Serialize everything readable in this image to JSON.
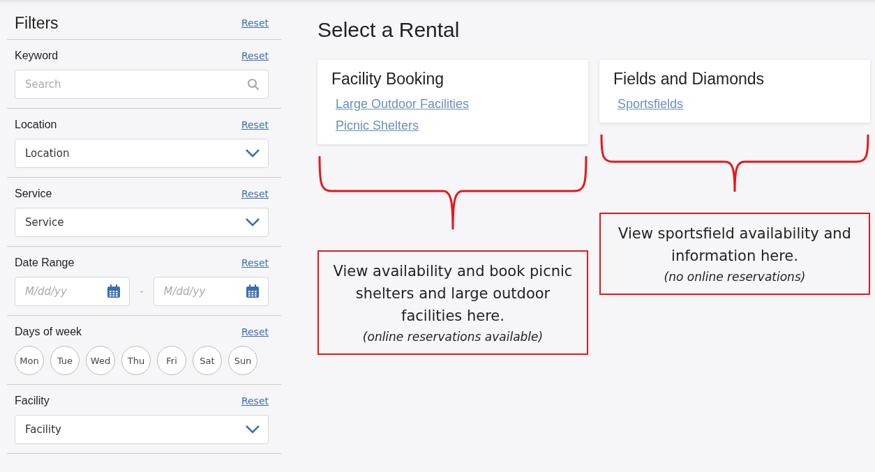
{
  "sidebar": {
    "title": "Filters",
    "reset": "Reset",
    "sections": [
      {
        "kind": "search",
        "label": "Keyword",
        "reset": "Reset",
        "placeholder": "Search"
      },
      {
        "kind": "select",
        "label": "Location",
        "reset": "Reset",
        "value": "Location"
      },
      {
        "kind": "select",
        "label": "Service",
        "reset": "Reset",
        "value": "Service"
      },
      {
        "kind": "dates",
        "label": "Date Range",
        "reset": "Reset",
        "from_placeholder": "M/dd/yy",
        "separator": "-",
        "to_placeholder": "M/dd/yy"
      },
      {
        "kind": "days",
        "label": "Days of week",
        "reset": "Reset",
        "days": [
          {
            "label": "Mon",
            "selected": false
          },
          {
            "label": "Tue",
            "selected": false
          },
          {
            "label": "Wed",
            "selected": false
          },
          {
            "label": "Thu",
            "selected": false
          },
          {
            "label": "Fri",
            "selected": false
          },
          {
            "label": "Sat",
            "selected": false
          },
          {
            "label": "Sun",
            "selected": false
          }
        ]
      },
      {
        "kind": "select",
        "label": "Facility",
        "reset": "Reset",
        "value": "Facility"
      }
    ]
  },
  "main": {
    "title": "Select a Rental",
    "categories": [
      {
        "title": "Facility Booking",
        "links": [
          "Large Outdoor Facilities",
          "Picnic Shelters"
        ],
        "callout": {
          "text": "View availability and book picnic shelters and large outdoor facilities here.",
          "note": "(online reservations available)"
        }
      },
      {
        "title": "Fields and Diamonds",
        "links": [
          "Sportsfields"
        ],
        "callout": {
          "text": "View sportsfield availability and information here.",
          "note": "(no online reservations)"
        }
      }
    ]
  }
}
